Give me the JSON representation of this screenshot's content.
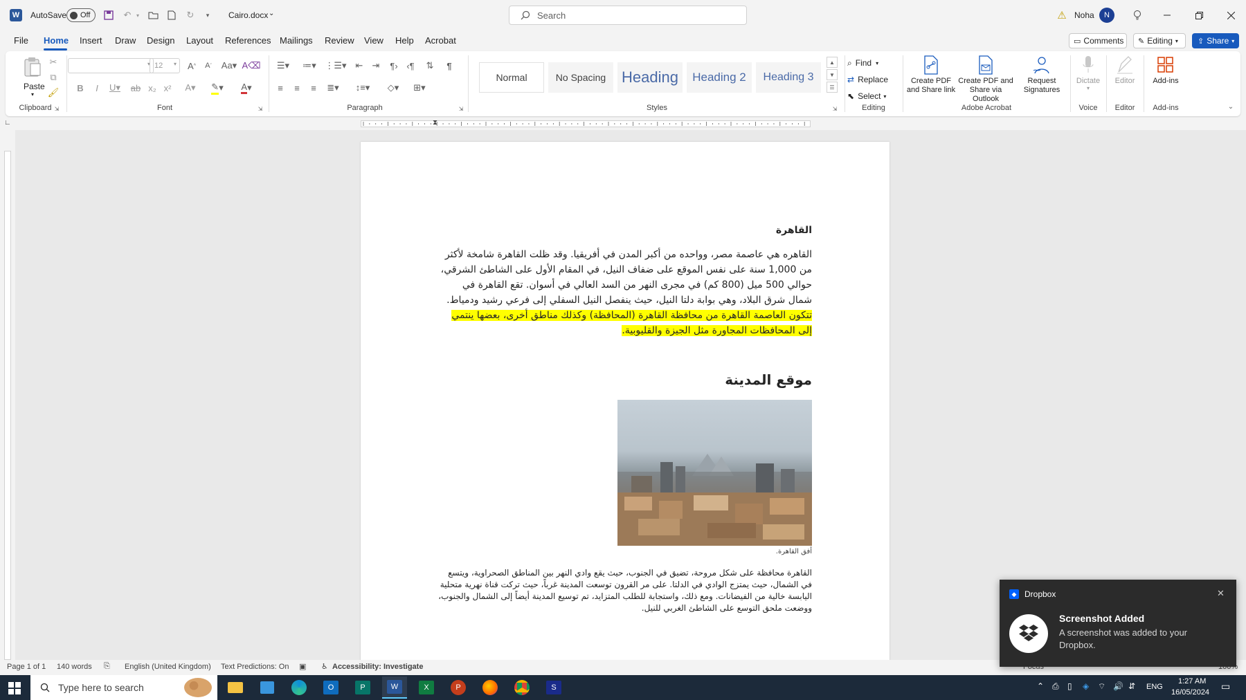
{
  "titlebar": {
    "autosave_label": "AutoSave",
    "autosave_state": "Off",
    "filename": "Cairo.docx",
    "search_placeholder": "Search",
    "user_name": "Noha",
    "user_initial": "N"
  },
  "menu": {
    "tabs": [
      "File",
      "Home",
      "Insert",
      "Draw",
      "Design",
      "Layout",
      "References",
      "Mailings",
      "Review",
      "View",
      "Help",
      "Acrobat"
    ],
    "active": "Home",
    "comments_label": "Comments",
    "editing_label": "Editing",
    "share_label": "Share"
  },
  "ribbon": {
    "paste_label": "Paste",
    "font_size": "12",
    "groups": {
      "clipboard": "Clipboard",
      "font": "Font",
      "paragraph": "Paragraph",
      "styles": "Styles",
      "editing": "Editing",
      "adobe": "Adobe Acrobat",
      "voice": "Voice",
      "editor": "Editor",
      "addins": "Add-ins"
    },
    "styles": [
      "Normal",
      "No Spacing",
      "Heading",
      "Heading 2",
      "Heading 3"
    ],
    "editing_items": {
      "find": "Find",
      "replace": "Replace",
      "select": "Select"
    },
    "acrobat": {
      "create_pdf_l1": "Create PDF",
      "create_pdf_l2": "and Share link",
      "create_outlook_l1": "Create PDF and",
      "create_outlook_l2": "Share via Outlook",
      "request_l1": "Request",
      "request_l2": "Signatures"
    },
    "dictate_label": "Dictate",
    "editor_label": "Editor",
    "addins_label": "Add-ins"
  },
  "document": {
    "title": "القاهرة",
    "para1_plain": "القاهره هي عاصمة مصر، وواحده من أكبر المدن في أفريقيا. وقد ظلت القاهرة شامخة لأكثر من 1,000 سنة على نفس الموقع على ضفاف النيل، في المقام الأول على الشاطئ الشرقي، حوالي 500 ميل (800 كم) في مجرى النهر من السد العالي في أسوان. تقع القاهرة في شمال شرق البلاد، وهي بوابة دلتا النيل، حيث ينفصل النيل السفلي إلى فرعي رشيد ودمياط. ",
    "para1_highlight": "تتكون العاصمة القاهرة من محافظة القاهرة (المحافظة) وكذلك مناطق أخرى، بعضها ينتمي إلى المحافظات المجاورة مثل الجيزة والقليوبية.",
    "heading2": "موقع المدينة",
    "image_caption": "أفق القاهرة.",
    "para2": "القاهرة محافظة على شكل مروحة، تضيق في الجنوب، حيث يقع وادي النهر بين المناطق الصحراوية، ويتسع في الشمال، حيث يمتزج الوادي في الدلتا. على مر القرون توسعت المدينة غرباً، حيث تركت قناة نهرية متحلية اليابسة خالية من الفيضانات. ومع ذلك، واستجابة للطلب المتزايد، تم توسيع المدينة أيضاً إلى الشمال والجنوب، ووضعت ملحق التوسع على الشاطئ الغربي للنيل."
  },
  "status": {
    "page": "Page 1 of 1",
    "words": "140 words",
    "language": "English (United Kingdom)",
    "predictions": "Text Predictions: On",
    "accessibility": "Accessibility: Investigate",
    "focus": "Focus",
    "zoom": "100%"
  },
  "taskbar": {
    "search_placeholder": "Type here to search",
    "lang": "ENG",
    "time": "1:27 AM",
    "date": "16/05/2024"
  },
  "toast": {
    "app": "Dropbox",
    "title": "Screenshot Added",
    "body": "A screenshot was added to your Dropbox."
  },
  "colors": {
    "accent": "#185abd",
    "word_blue": "#2b579a",
    "highlight": "#ffff00",
    "taskbar": "#1c2a3a",
    "toast_bg": "#2b2b2b"
  }
}
